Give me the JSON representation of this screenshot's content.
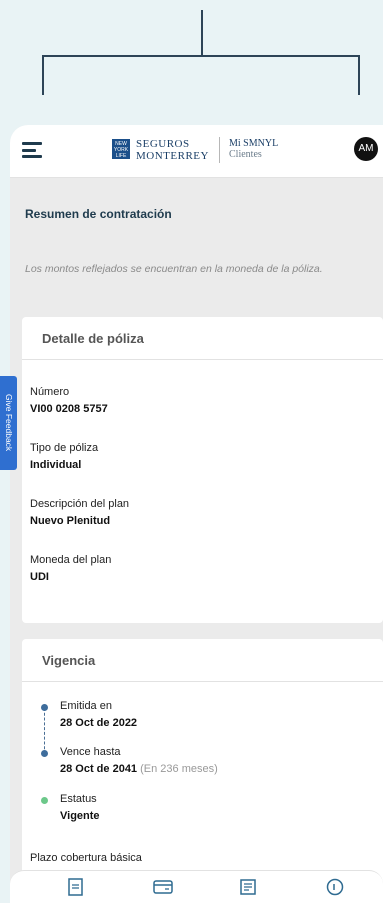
{
  "header": {
    "logo_text": "NEW YORK LIFE",
    "brand_line1": "SEGUROS",
    "brand_line2": "MONTERREY",
    "app_line1": "Mi SMNYL",
    "app_line2": "Clientes",
    "avatar_initials": "AM"
  },
  "summary": {
    "title": "Resumen de contratación",
    "notice": "Los montos reflejados se encuentran en la moneda de la póliza."
  },
  "policy_detail": {
    "title": "Detalle de póliza",
    "fields": [
      {
        "label": "Número",
        "value": "VI00 0208 5757"
      },
      {
        "label": "Tipo de póliza",
        "value": "Individual"
      },
      {
        "label": "Descripción del plan",
        "value": "Nuevo Plenitud"
      },
      {
        "label": "Moneda del plan",
        "value": "UDI"
      }
    ]
  },
  "feedback": {
    "label": "Give Feedback"
  },
  "validity": {
    "title": "Vigencia",
    "issued_label": "Emitida en",
    "issued_value": "28 Oct de 2022",
    "expires_label": "Vence hasta",
    "expires_value": "28 Oct de 2041",
    "expires_extra": "(En 236 meses)",
    "status_label": "Estatus",
    "status_value": "Vigente",
    "coverage_label": "Plazo cobertura básica"
  },
  "colors": {
    "accent": "#1f3b4d",
    "brand_blue": "#1b4f8a",
    "feedback": "#2f6fd0",
    "status_green": "#6cc88a"
  },
  "nav_icons": [
    "policy-icon",
    "payment-card-icon",
    "document-icon",
    "notification-icon"
  ]
}
